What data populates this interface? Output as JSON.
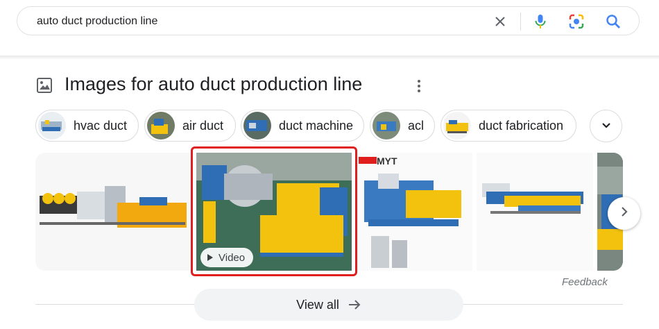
{
  "search": {
    "query": "auto duct production line",
    "icons": [
      "clear-icon",
      "microphone-icon",
      "lens-camera-icon",
      "search-icon"
    ]
  },
  "images_section": {
    "title": "Images for auto duct production line",
    "icon": "image-icon",
    "more_icon": "more-vert-icon"
  },
  "chips": [
    {
      "label": "hvac duct"
    },
    {
      "label": "air duct"
    },
    {
      "label": "duct machine"
    },
    {
      "label": "acl"
    },
    {
      "label": "duct fabrication"
    }
  ],
  "gallery": {
    "video_badge": "Video",
    "watermark": "MYT",
    "next_icon": "chevron-right-icon"
  },
  "feedback": "Feedback",
  "view_all": "View all",
  "colors": {
    "google_blue": "#4285F4",
    "google_red": "#EA4335",
    "google_yellow": "#FBBC04",
    "google_green": "#34A853",
    "selection_red": "#e01e1e",
    "machine_yellow": "#f2c20f",
    "machine_blue": "#2f6db5"
  }
}
